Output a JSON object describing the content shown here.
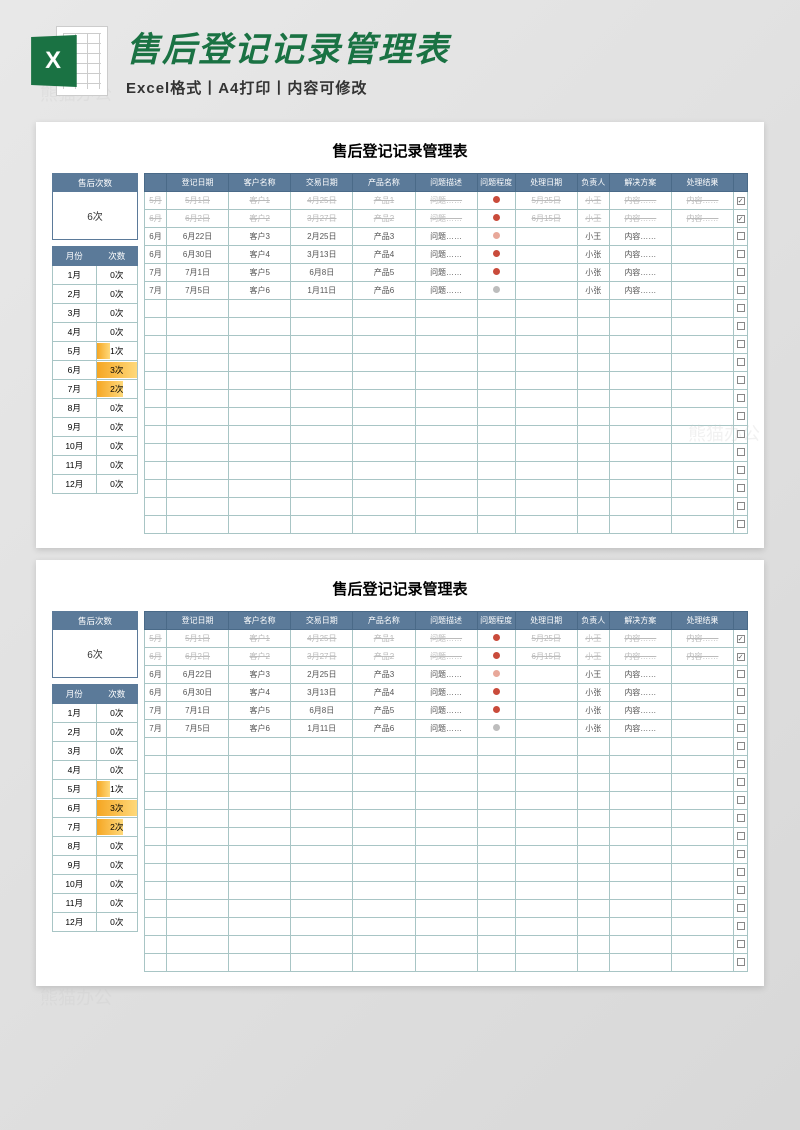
{
  "header": {
    "icon_letter": "X",
    "main_title": "售后登记记录管理表",
    "sub_title": "Excel格式丨A4打印丨内容可修改"
  },
  "page_title": "售后登记记录管理表",
  "stat": {
    "label": "售后次数",
    "value": "6次"
  },
  "month_headers": [
    "月份",
    "次数"
  ],
  "months": [
    {
      "m": "1月",
      "v": "0次",
      "bar": 0
    },
    {
      "m": "2月",
      "v": "0次",
      "bar": 0
    },
    {
      "m": "3月",
      "v": "0次",
      "bar": 0
    },
    {
      "m": "4月",
      "v": "0次",
      "bar": 0
    },
    {
      "m": "5月",
      "v": "1次",
      "bar": 33
    },
    {
      "m": "6月",
      "v": "3次",
      "bar": 100
    },
    {
      "m": "7月",
      "v": "2次",
      "bar": 66
    },
    {
      "m": "8月",
      "v": "0次",
      "bar": 0
    },
    {
      "m": "9月",
      "v": "0次",
      "bar": 0
    },
    {
      "m": "10月",
      "v": "0次",
      "bar": 0
    },
    {
      "m": "11月",
      "v": "0次",
      "bar": 0
    },
    {
      "m": "12月",
      "v": "0次",
      "bar": 0
    }
  ],
  "table_headers": [
    "",
    "登记日期",
    "客户名称",
    "交易日期",
    "产品名称",
    "问题描述",
    "问题程度",
    "处理日期",
    "负责人",
    "解决方案",
    "处理结果",
    ""
  ],
  "rows": [
    {
      "faded": true,
      "c": [
        "5月",
        "5月1日",
        "客户1",
        "4月25日",
        "产品1",
        "问题……",
        "#c94b3b",
        "5月25日",
        "小王",
        "内容……",
        "内容……",
        "✓"
      ]
    },
    {
      "faded": true,
      "c": [
        "6月",
        "6月2日",
        "客户2",
        "3月27日",
        "产品2",
        "问题……",
        "#c94b3b",
        "6月15日",
        "小王",
        "内容……",
        "内容……",
        "✓"
      ]
    },
    {
      "faded": false,
      "c": [
        "6月",
        "6月22日",
        "客户3",
        "2月25日",
        "产品3",
        "问题……",
        "#e8a89a",
        "",
        "小王",
        "内容……",
        "",
        ""
      ]
    },
    {
      "faded": false,
      "c": [
        "6月",
        "6月30日",
        "客户4",
        "3月13日",
        "产品4",
        "问题……",
        "#c94b3b",
        "",
        "小张",
        "内容……",
        "",
        ""
      ]
    },
    {
      "faded": false,
      "c": [
        "7月",
        "7月1日",
        "客户5",
        "6月8日",
        "产品5",
        "问题……",
        "#c94b3b",
        "",
        "小张",
        "内容……",
        "",
        ""
      ]
    },
    {
      "faded": false,
      "c": [
        "7月",
        "7月5日",
        "客户6",
        "1月11日",
        "产品6",
        "问题……",
        "#bdbdbd",
        "",
        "小张",
        "内容……",
        "",
        ""
      ]
    }
  ],
  "empty_rows": 13,
  "colors": {
    "header_bg": "#5b7a99"
  }
}
